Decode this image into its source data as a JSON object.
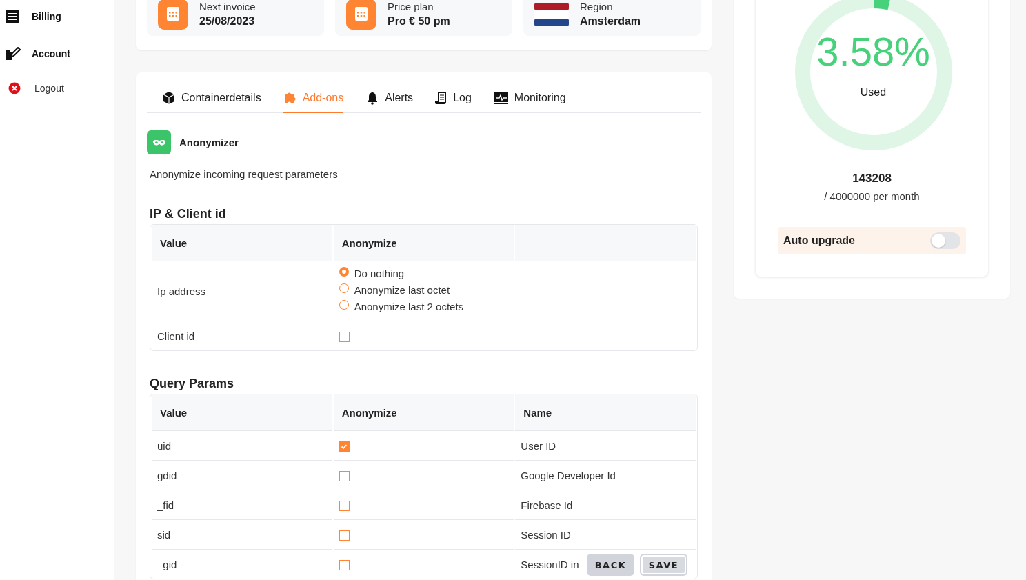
{
  "sidebar": {
    "items": [
      {
        "label": "Billing",
        "kind": "billing"
      },
      {
        "label": "Account",
        "kind": "account"
      },
      {
        "label": "Logout",
        "kind": "logout"
      }
    ]
  },
  "summary_cards": [
    {
      "label": "Next invoice",
      "value": "25/08/2023",
      "kind": "calendar"
    },
    {
      "label": "Price plan",
      "value": "Pro € 50 pm",
      "kind": "calendar"
    },
    {
      "label": "Region",
      "value": "Amsterdam",
      "kind": "flag"
    }
  ],
  "tabs": [
    {
      "label": "Containerdetails",
      "kind": "cube",
      "selected": false
    },
    {
      "label": "Add-ons",
      "kind": "puzzle",
      "selected": true
    },
    {
      "label": "Alerts",
      "kind": "bell",
      "selected": false
    },
    {
      "label": "Log",
      "kind": "log",
      "selected": false
    },
    {
      "label": "Monitoring",
      "kind": "monitor",
      "selected": false
    }
  ],
  "addon": {
    "title": "Anonymizer",
    "description": "Anonymize incoming request parameters"
  },
  "sections": [
    {
      "title": "IP & Client id",
      "columns": [
        "Value",
        "Anonymize"
      ],
      "rows": [
        {
          "value": "Ip address",
          "kind": "radio",
          "options": [
            {
              "label": "Do nothing",
              "selected": true
            },
            {
              "label": "Anonymize last octet",
              "selected": false
            },
            {
              "label": "Anonymize last 2 octets",
              "selected": false
            }
          ]
        },
        {
          "value": "Client id",
          "kind": "checkbox",
          "checked": false
        }
      ]
    },
    {
      "title": "Query Params",
      "columns": [
        "Value",
        "Anonymize",
        "Name"
      ],
      "rows": [
        {
          "value": "uid",
          "kind": "checkbox",
          "checked": true,
          "name": "User ID"
        },
        {
          "value": "gdid",
          "kind": "checkbox",
          "checked": false,
          "name": "Google Developer Id"
        },
        {
          "value": "_fid",
          "kind": "checkbox",
          "checked": false,
          "name": "Firebase Id"
        },
        {
          "value": "sid",
          "kind": "checkbox",
          "checked": false,
          "name": "Session ID"
        },
        {
          "value": "_gid",
          "kind": "checkbox",
          "checked": false,
          "name": "SessionID in"
        }
      ]
    }
  ],
  "usage": {
    "percent": "3.58%",
    "level": 0.0358,
    "caption": "Used",
    "count": "143208",
    "limit": "/ 4000000 per month",
    "auto_upgrade": {
      "label": "Auto upgrade",
      "on": false
    }
  },
  "buttons": [
    {
      "label": "BACK",
      "focused": false
    },
    {
      "label": "SAVE",
      "focused": true
    }
  ]
}
